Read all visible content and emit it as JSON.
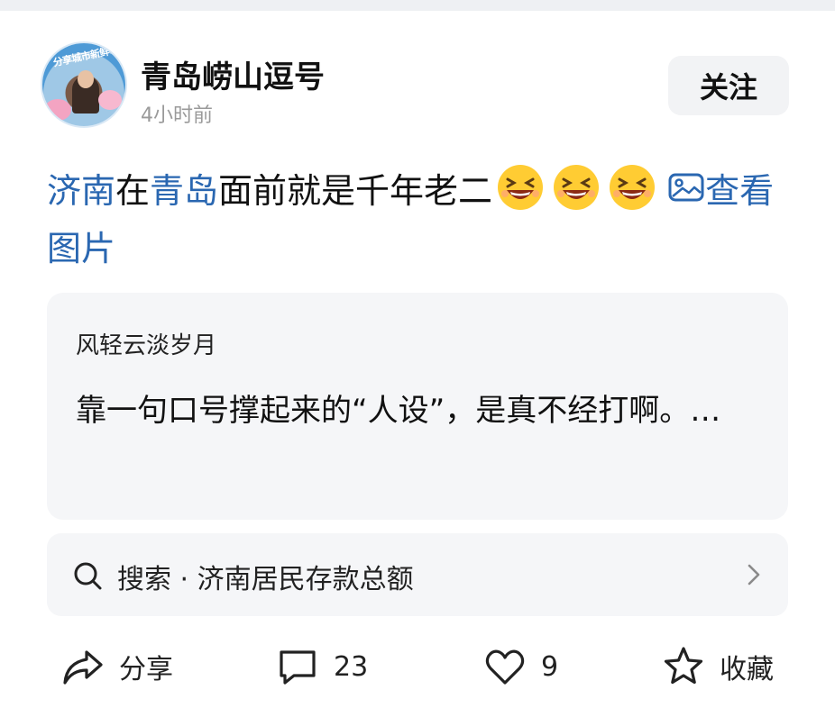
{
  "header": {
    "avatar_caption": "分享城市新鲜事",
    "author_name": "青岛崂山逗号",
    "time_ago": "4小时前",
    "follow_label": "关注"
  },
  "post": {
    "link1": "济南",
    "text1": "在",
    "link2": "青岛",
    "text2": "面前就是千年老二",
    "emojis": [
      "grinning-squint-face",
      "grinning-squint-face",
      "grinning-squint-face"
    ],
    "view_image_label": "查看图片",
    "view_image_icon": "image-icon"
  },
  "quote": {
    "author": "风轻云淡岁月",
    "text": "靠一句口号撑起来的“人设”，是真不经打啊。…"
  },
  "search": {
    "icon": "search-icon",
    "text": "搜索 · 济南居民存款总额",
    "chevron": "chevron-right-icon"
  },
  "actions": {
    "share_label": "分享",
    "comment_count": "23",
    "like_count": "9",
    "favorite_label": "收藏"
  },
  "colors": {
    "link": "#2a67b1",
    "card_bg": "#f5f6f8",
    "follow_bg": "#f2f3f5",
    "muted": "#9a9a9a"
  }
}
